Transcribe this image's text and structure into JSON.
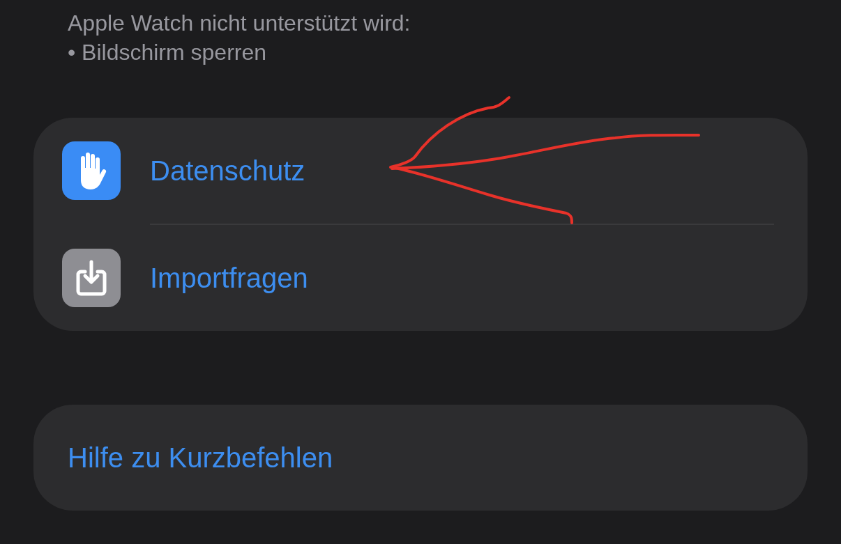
{
  "note_lines": [
    "Apple Watch nicht unterstützt wird:",
    "• Bildschirm sperren"
  ],
  "links_group": [
    {
      "label": "Datenschutz",
      "kind": "hand",
      "color": "#3a8cf5"
    },
    {
      "label": "Importfragen",
      "kind": "import",
      "color": "#8e8e93"
    }
  ],
  "help_link": {
    "label": "Hilfe zu Kurzbefehlen"
  }
}
